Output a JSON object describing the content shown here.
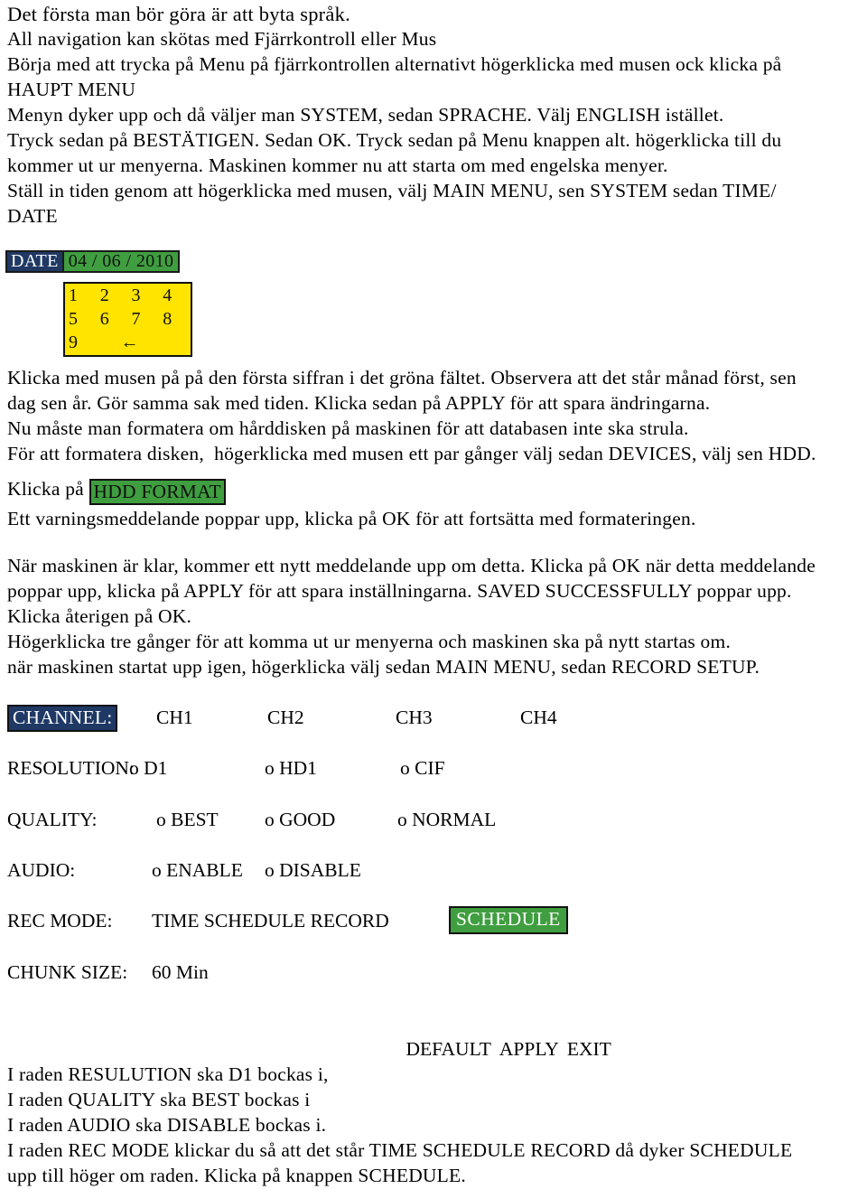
{
  "document": {
    "intro_lines": [
      "Det första man bör göra är att byta språk.",
      "All navigation kan skötas med Fjärrkontroll eller Mus",
      "Börja med att trycka på Menu på fjärrkontrollen alternativt högerklicka med musen ock klicka på",
      "HAUPT MENU",
      "Menyn dyker upp och då väljer man SYSTEM, sedan SPRACHE. Välj ENGLISH istället.",
      "Tryck sedan på BESTÄTIGEN. Sedan OK. Tryck sedan på Menu knappen alt. högerklicka till du",
      "kommer ut ur menyerna. Maskinen kommer nu att starta om med engelska menyer.",
      "Ställ in tiden genom att högerklicka med musen, välj MAIN MENU, sen SYSTEM sedan TIME/",
      "DATE"
    ],
    "date_widget": {
      "label": "DATE",
      "value": "04 / 06 / 2010",
      "keypad_rows": [
        [
          "1",
          "2",
          "3",
          "4"
        ],
        [
          "5",
          "6",
          "7",
          "8"
        ],
        [
          "9",
          "←"
        ]
      ],
      "backspace_glyph": "←",
      "label_bg": "#1F3864",
      "value_bg": "#3F9E3F",
      "keypad_bg": "#FFE400"
    },
    "middle_lines": [
      "Klicka med musen på på den första siffran i det gröna fältet. Observera att det står månad först, sen",
      "dag sen år. Gör samma sak med tiden. Klicka sedan på APPLY för att spara ändringarna.",
      "Nu måste man formatera om hårddisken på maskinen för att databasen inte ska strula.",
      "För att formatera disken,  högerklicka med musen ett par gånger välj sedan DEVICES, välj sen HDD."
    ],
    "hdd_format_line": {
      "prefix": "Klicka på ",
      "button": "HDD FORMAT"
    },
    "after_hdd_line": "Ett varningsmeddelande poppar upp, klicka på OK för att fortsätta med formateringen.",
    "second_block_lines": [
      "När maskinen är klar, kommer ett nytt meddelande upp om detta. Klicka på OK när detta meddelande",
      "poppar upp, klicka på APPLY för att spara inställningarna. SAVED SUCCESSFULLY poppar upp.",
      "Klicka återigen på OK.",
      "Högerklicka tre gånger för att komma ut ur menyerna och maskinen ska på nytt startas om.",
      "när maskinen startat upp igen, högerklicka välj sedan MAIN MENU, sedan RECORD SETUP."
    ],
    "record_setup": {
      "channel": {
        "label": "CHANNEL:",
        "options": [
          "CH1",
          "CH2",
          "CH3",
          "CH4"
        ]
      },
      "resolution": {
        "label": "RESOLUTION:",
        "options": [
          "o D1",
          "o HD1",
          "o CIF"
        ]
      },
      "quality": {
        "label": "QUALITY:",
        "options": [
          "o BEST",
          "o GOOD",
          "o NORMAL"
        ]
      },
      "audio": {
        "label": "AUDIO:",
        "options": [
          "o ENABLE",
          "o DISABLE"
        ]
      },
      "rec_mode": {
        "label": "REC MODE:",
        "value": "TIME SCHEDULE RECORD",
        "button": "SCHEDULE"
      },
      "chunk_size": {
        "label": "CHUNK SIZE:",
        "value": "60 Min"
      },
      "actions": [
        "DEFAULT",
        "APPLY",
        "EXIT"
      ]
    },
    "final_lines": [
      "I raden RESULUTION ska D1 bockas i,",
      "I raden QUALITY ska BEST bockas i",
      "I raden AUDIO ska DISABLE bockas i.",
      "I raden REC MODE klickar du så att det står TIME SCHEDULE RECORD då dyker SCHEDULE",
      "upp till höger om raden. Klicka på knappen SCHEDULE."
    ]
  }
}
